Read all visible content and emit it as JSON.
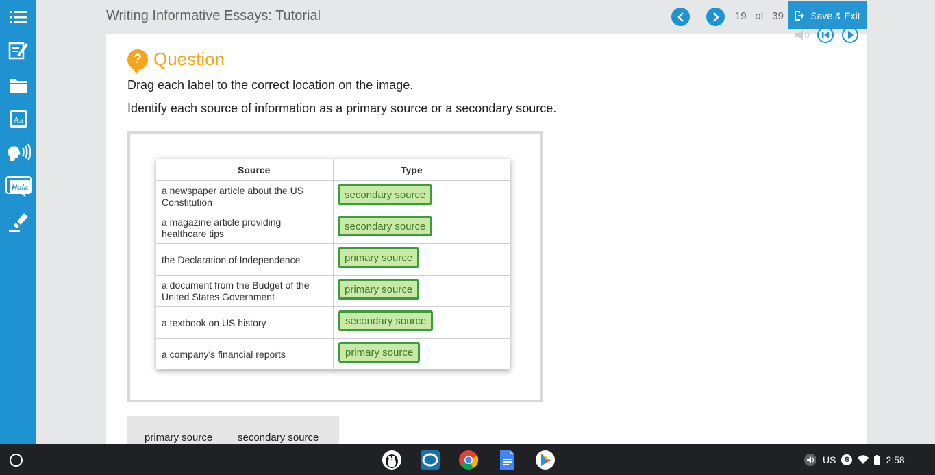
{
  "header": {
    "title": "Writing Informative Essays: Tutorial",
    "page_current": "19",
    "page_of": "of",
    "page_total": "39",
    "save_label": "Save & Exit"
  },
  "sidebar": {
    "items": [
      {
        "icon": "table-of-contents-icon"
      },
      {
        "icon": "notes-icon"
      },
      {
        "icon": "folder-icon"
      },
      {
        "icon": "dictionary-icon",
        "text": "Aa"
      },
      {
        "icon": "text-to-speech-icon"
      },
      {
        "icon": "translate-icon",
        "text": "Hola"
      },
      {
        "icon": "highlighter-icon"
      }
    ]
  },
  "question": {
    "heading": "Question",
    "instruction1": "Drag each label to the correct location on the image.",
    "instruction2": "Identify each source of information as a primary source or a secondary source."
  },
  "table": {
    "col_source": "Source",
    "col_type": "Type",
    "rows": [
      {
        "source": "a newspaper article about the US Constitution",
        "type": "secondary source"
      },
      {
        "source": "a magazine article providing healthcare tips",
        "type": "secondary source"
      },
      {
        "source": "the Declaration of Independence",
        "type": "primary source"
      },
      {
        "source": "a document from the Budget of the United States Government",
        "type": "primary source"
      },
      {
        "source": "a textbook on US history",
        "type": "secondary source"
      },
      {
        "source": "a company's financial reports",
        "type": "primary source"
      }
    ]
  },
  "bank": {
    "items": [
      "primary source",
      "secondary source"
    ]
  },
  "taskbar": {
    "apps": [
      "penguin-app-icon",
      "camera-app-icon",
      "chrome-icon",
      "docs-icon",
      "play-store-icon"
    ],
    "locale": "US",
    "notif_count": "8",
    "time": "2:58"
  },
  "colors": {
    "brand_blue": "#1f93d1",
    "accent_orange": "#f4a51c",
    "label_green_border": "#3a9d3a",
    "label_green_fill": "#c8eaa6"
  }
}
